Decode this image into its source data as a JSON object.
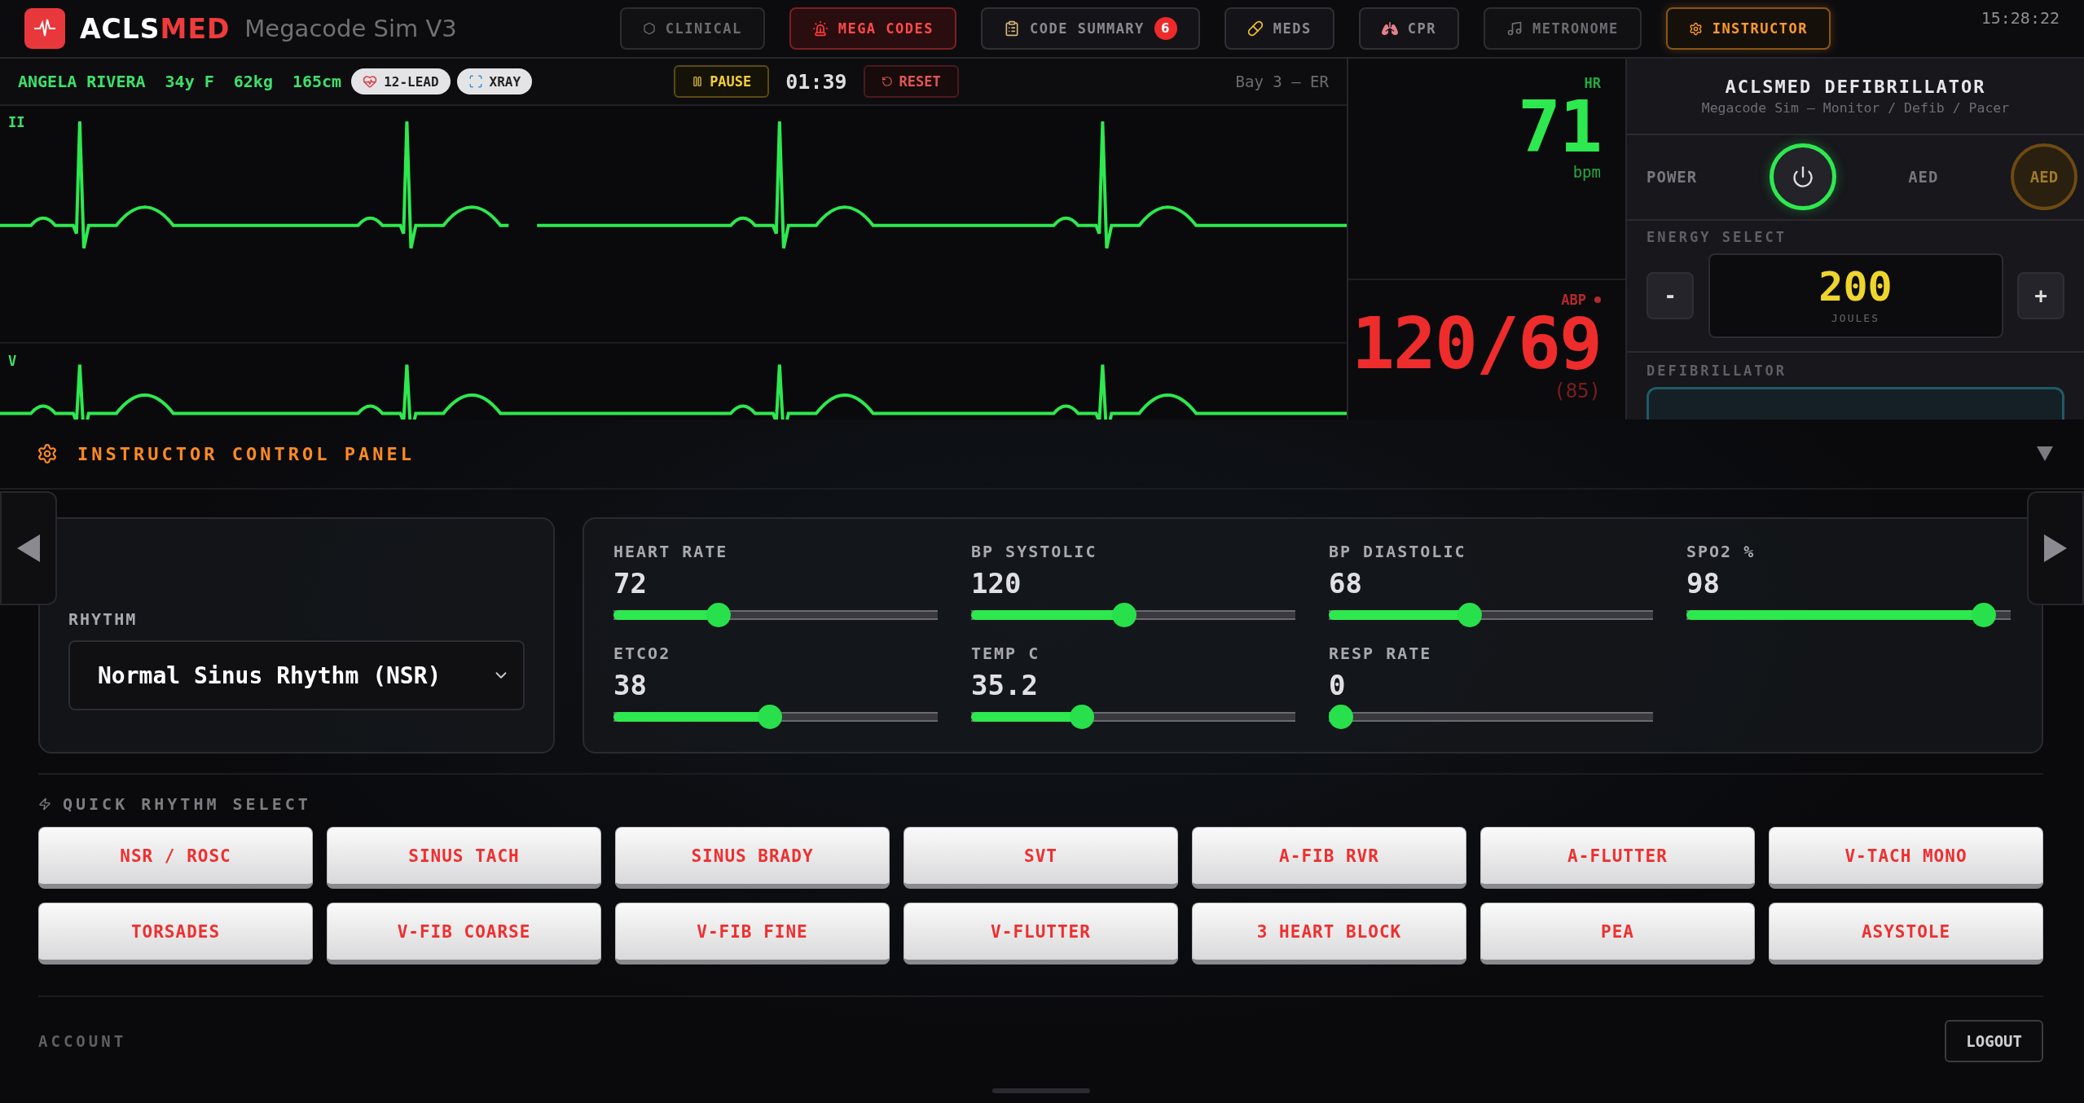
{
  "header": {
    "brand_first": "ACLS",
    "brand_second": "MED",
    "subtitle": "Megacode Sim V3",
    "time": "15:28:22",
    "nav": [
      {
        "label": "CLINICAL",
        "kind": "muted",
        "selected": false
      },
      {
        "label": "MEGA CODES",
        "kind": "alert",
        "selected": false
      },
      {
        "label": "CODE SUMMARY",
        "kind": "normal",
        "badge": "6",
        "selected": false
      },
      {
        "label": "MEDS",
        "kind": "normal",
        "selected": false
      },
      {
        "label": "CPR",
        "kind": "normal",
        "selected": false
      },
      {
        "label": "METRONOME",
        "kind": "muted",
        "selected": false
      },
      {
        "label": "INSTRUCTOR",
        "kind": "normal",
        "selected": true
      }
    ]
  },
  "patient": {
    "name": "ANGELA RIVERA",
    "age_sex": "34y F",
    "weight": "62kg",
    "height": "165cm",
    "chips": [
      "12-LEAD",
      "XRAY"
    ],
    "pause": "PAUSE",
    "timer": "01:39",
    "reset": "RESET",
    "location": "Bay 3 — ER"
  },
  "leads": [
    "II",
    "V"
  ],
  "vitals": {
    "hr_label": "HR",
    "hr": "71",
    "hr_unit": "bpm",
    "abp_label": "ABP",
    "abp": "120/69",
    "abp_mean": "(85)"
  },
  "defib": {
    "title": "ACLSMED DEFIBRILLATOR",
    "subtitle": "Megacode Sim — Monitor / Defib / Pacer",
    "power_label": "POWER",
    "power_on": true,
    "aed_label": "AED",
    "aed_button": "AED",
    "energy_label": "ENERGY SELECT",
    "minus": "-",
    "plus": "+",
    "energy": "200",
    "energy_unit": "JOULES",
    "section": "DEFIBRILLATOR"
  },
  "instructor": {
    "title": "INSTRUCTOR CONTROL PANEL",
    "expanded": true,
    "rhythm_label": "RHYTHM",
    "rhythm": "Normal Sinus Rhythm (NSR)",
    "sliders": [
      {
        "label": "HEART RATE",
        "value": "72",
        "level": 0.31
      },
      {
        "label": "BP SYSTOLIC",
        "value": "120",
        "level": 0.47
      },
      {
        "label": "BP DIASTOLIC",
        "value": "68",
        "level": 0.43
      },
      {
        "label": "SPO2 %",
        "value": "98",
        "level": 0.95
      },
      {
        "label": "ETCO2",
        "value": "38",
        "level": 0.48
      },
      {
        "label": "TEMP C",
        "value": "35.2",
        "level": 0.33
      },
      {
        "label": "RESP RATE",
        "value": "0",
        "level": 0
      }
    ],
    "quick_title": "QUICK RHYTHM SELECT",
    "rhythms": [
      "NSR / ROSC",
      "SINUS TACH",
      "SINUS BRADY",
      "SVT",
      "A-FIB RVR",
      "A-FLUTTER",
      "V-TACH MONO",
      "TORSADES",
      "V-FIB COARSE",
      "V-FIB FINE",
      "V-FLUTTER",
      "3 HEART BLOCK",
      "PEA",
      "ASYSTOLE"
    ],
    "account": "ACCOUNT",
    "logout": "LOGOUT"
  }
}
